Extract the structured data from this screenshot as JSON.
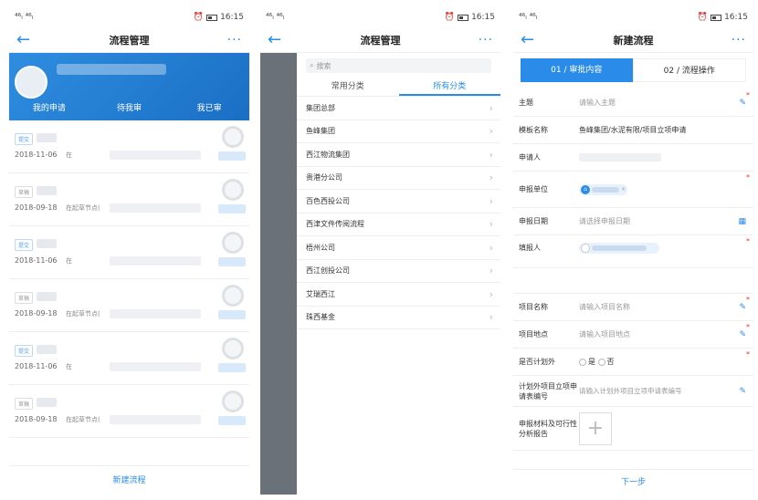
{
  "status": {
    "signal": "⁴⁶ₗ ⁴⁶ₗ",
    "time": "16:15"
  },
  "screen1": {
    "title": "流程管理",
    "tabs": [
      "我的申请",
      "待我审",
      "我已审"
    ],
    "items": [
      {
        "date": "2018-11-06",
        "info": "在"
      },
      {
        "date": "2018-09-18",
        "info": "在起草节点("
      },
      {
        "date": "2018-11-06",
        "info": "在"
      },
      {
        "date": "2018-09-18",
        "info": "在起草节点("
      },
      {
        "date": "2018-11-06",
        "info": "在"
      },
      {
        "date": "2018-09-18",
        "info": "在起草节点("
      }
    ],
    "bottom_label": "新建流程"
  },
  "screen2": {
    "title": "流程管理",
    "search_placeholder": "搜索",
    "tabs": [
      "常用分类",
      "所有分类"
    ],
    "categories": [
      "集团总部",
      "鱼峰集团",
      "西江物流集团",
      "贵港分公司",
      "百色西投公司",
      "西津文件传阅流程",
      "梧州公司",
      "西江创投公司",
      "艾瑞西江",
      "珠西基金"
    ]
  },
  "screen3": {
    "title": "新建流程",
    "tab1": "01 / 审批内容",
    "tab2": "02 / 流程操作",
    "fields": {
      "subject_label": "主题",
      "subject_ph": "请输入主题",
      "template_label": "模板名称",
      "template_val": "鱼峰集团/水泥有限/项目立项申请",
      "applicant_label": "申请人",
      "unit_label": "申报单位",
      "date_label": "申报日期",
      "date_ph": "请选择申报日期",
      "filler_label": "填报人",
      "proj_name_label": "项目名称",
      "proj_name_ph": "请输入项目名称",
      "proj_loc_label": "项目地点",
      "proj_loc_ph": "请输入项目地点",
      "plan_label": "是否计划外",
      "yes": "是",
      "no": "否",
      "outside_label": "计划外项目立项申请表编号",
      "outside_ph": "请输入计划外项目立项申请表编号",
      "material_label": "申报材料及可行性分析报告"
    },
    "next_label": "下一步"
  }
}
